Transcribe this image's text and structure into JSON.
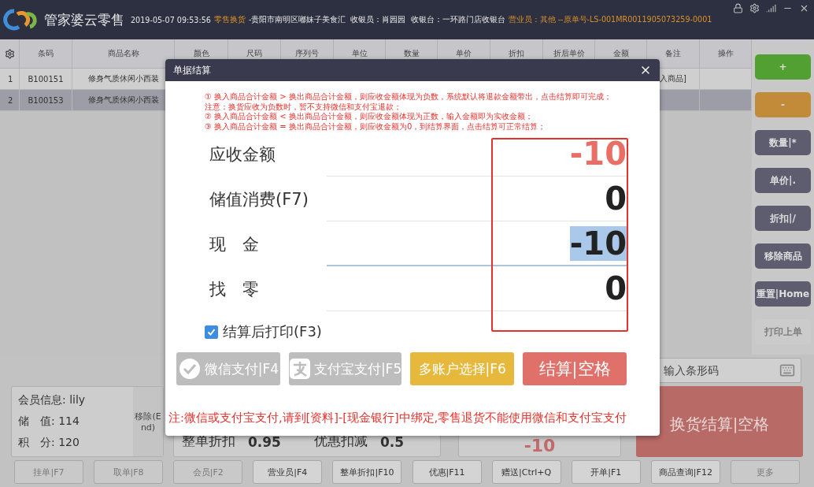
{
  "header": {
    "app_name": "管家婆云零售",
    "datetime": "2019-05-07 09:53:56",
    "status": [
      {
        "text": "零售换货",
        "highlight": true
      },
      {
        "text": "-贵阳市南明区嘟妹子美食汇  收银员：肖园园  收银台：一环路门店收银台",
        "highlight": false
      },
      {
        "text": "营业员：其他 --原单号-LS-001MR0011905073259-0001",
        "highlight": true
      }
    ]
  },
  "table": {
    "columns": [
      "条码",
      "商品名称",
      "颜色",
      "尺码",
      "序列号",
      "单位",
      "数量",
      "单价",
      "折扣",
      "折后单价",
      "金额",
      "备注",
      "操作"
    ],
    "rows": [
      {
        "index": "1",
        "barcode": "B100151",
        "name": "修身气质休闲小西装",
        "remark": "入商品]",
        "selected": false
      },
      {
        "index": "2",
        "barcode": "B100153",
        "name": "修身气质休闲小西装",
        "selected": true
      }
    ]
  },
  "side_buttons": [
    {
      "label": "+",
      "kind": "add",
      "disabled": false
    },
    {
      "label": "-",
      "kind": "subtract",
      "disabled": false
    },
    {
      "label": "数量|*",
      "kind": "action",
      "disabled": false
    },
    {
      "label": "单价|.",
      "kind": "action",
      "disabled": false
    },
    {
      "label": "折扣|/",
      "kind": "action",
      "disabled": false
    },
    {
      "label": "移除商品",
      "kind": "action",
      "disabled": false
    },
    {
      "label": "重置|Home",
      "kind": "action",
      "disabled": false
    },
    {
      "label": "打印上单",
      "kind": "action",
      "disabled": true
    }
  ],
  "barcode": {
    "placeholder": "输入条形码"
  },
  "member": {
    "lines": [
      "会员信息: lily",
      "储　值: 114",
      "积　分: 120"
    ]
  },
  "remove_button": "移除(End)",
  "discount": {
    "items": [
      {
        "label": "整单折扣",
        "value": "0.95"
      },
      {
        "label": "优惠扣减",
        "value": "0.5"
      }
    ]
  },
  "total": "-10",
  "checkout_button": "换货结算|空格",
  "footer_buttons": [
    {
      "label": "挂单|F7",
      "disabled": true
    },
    {
      "label": "取单|F8",
      "disabled": true
    },
    {
      "label": "会员|F2",
      "disabled": true
    },
    {
      "label": "营业员|F4",
      "disabled": false
    },
    {
      "label": "整单折扣|F10",
      "disabled": false
    },
    {
      "label": "优惠|F11",
      "disabled": false
    },
    {
      "label": "赠送|Ctrl+Q",
      "disabled": false
    },
    {
      "label": "开单|F1",
      "disabled": false
    },
    {
      "label": "商品查询|F12",
      "disabled": false
    },
    {
      "label": "更多",
      "disabled": true
    }
  ],
  "dialog": {
    "title": "单据结算",
    "notes": [
      "① 换入商品合计金额 > 换出商品合计金额，则应收金额体现为负数，系统默认将退款金额带出，点击结算即可完成；",
      "注意：换货应收为负数时，暂不支持微信和支付宝退款；",
      "② 换入商品合计金额 < 换出商品合计金额，则应收金额体现为正数，输入金额即为实收金额；",
      "③ 换入商品合计金额 = 换出商品合计金额，则应收金额为0，到结算界面，点击结算可正常结算；"
    ],
    "fields": [
      {
        "label": "应收金额",
        "value": "-10",
        "kind": "due",
        "selected": false
      },
      {
        "label": "储值消费(F7)",
        "value": "0",
        "kind": "plain",
        "selected": false
      },
      {
        "label": "现　金",
        "value": "-10",
        "kind": "input",
        "selected": true
      },
      {
        "label": "找　零",
        "value": "0",
        "kind": "plain",
        "selected": false
      }
    ],
    "print_after": {
      "label": "结算后打印(F3)",
      "checked": true
    },
    "buttons": [
      {
        "label": "微信支付|F4",
        "kind": "wechat",
        "disabled": true
      },
      {
        "label": "支付宝支付|F5",
        "kind": "alipay",
        "disabled": true
      },
      {
        "label": "多账户选择|F6",
        "kind": "multi",
        "disabled": false
      },
      {
        "label": "结算|空格",
        "kind": "settle",
        "disabled": false
      }
    ],
    "footnote": "注:微信或支付宝支付,请到[资料]-[现金银行]中绑定,零售退货不能使用微信和支付宝支付"
  }
}
